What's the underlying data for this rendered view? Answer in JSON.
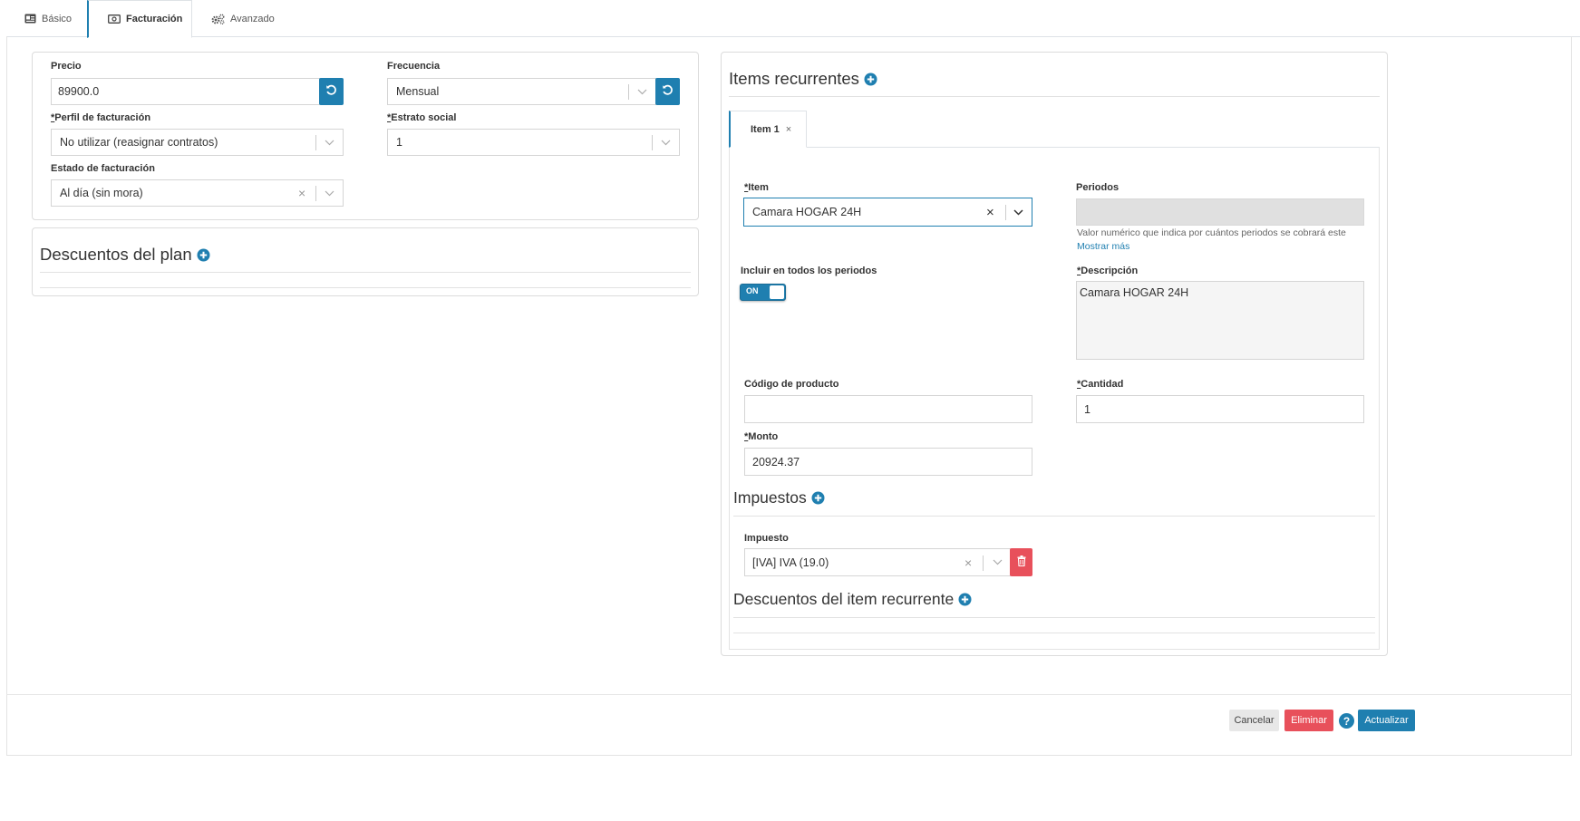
{
  "tabs": [
    {
      "label": "Básico",
      "icon": "id-card-icon"
    },
    {
      "label": "Facturación",
      "icon": "money-bill-icon"
    },
    {
      "label": "Avanzado",
      "icon": "gears-icon"
    }
  ],
  "billing": {
    "price": {
      "label": "Precio",
      "value": "89900.0"
    },
    "frequency": {
      "label": "Frecuencia",
      "value": "Mensual"
    },
    "billing_profile": {
      "required": "*",
      "label": "Perfil de facturación",
      "value": "No utilizar (reasignar contratos)"
    },
    "social_stratum": {
      "required": "*",
      "label": "Estrato social",
      "value": "1"
    },
    "billing_status": {
      "label": "Estado de facturación",
      "value": "Al día (sin mora)"
    }
  },
  "plan_discounts": {
    "title": "Descuentos del plan"
  },
  "recurring_items": {
    "title": "Items recurrentes",
    "tab_label": "Item 1",
    "tab_close": "×",
    "item": {
      "required": "*",
      "label": "Item",
      "value": "Camara HOGAR 24H"
    },
    "periods": {
      "label": "Periodos",
      "value": "",
      "hint": "Valor numérico que indica por cuántos periodos se cobrará este",
      "more": "Mostrar más"
    },
    "include_all": {
      "label": "Incluir en todos los periodos",
      "toggle": "ON"
    },
    "description": {
      "required": "*",
      "label": "Descripción",
      "value": "Camara HOGAR 24H"
    },
    "product_code": {
      "label": "Código de producto",
      "value": ""
    },
    "quantity": {
      "required": "*",
      "label": "Cantidad",
      "value": "1"
    },
    "amount": {
      "required": "*",
      "label": "Monto",
      "value": "20924.37"
    },
    "taxes": {
      "title": "Impuestos",
      "label": "Impuesto",
      "value": "[IVA] IVA (19.0)"
    },
    "item_discounts": {
      "title": "Descuentos del item recurrente"
    }
  },
  "footer": {
    "cancel": "Cancelar",
    "delete": "Eliminar",
    "help": "?",
    "update": "Actualizar"
  },
  "colors": {
    "primary": "#1f7fb0",
    "danger": "#e8505b"
  }
}
